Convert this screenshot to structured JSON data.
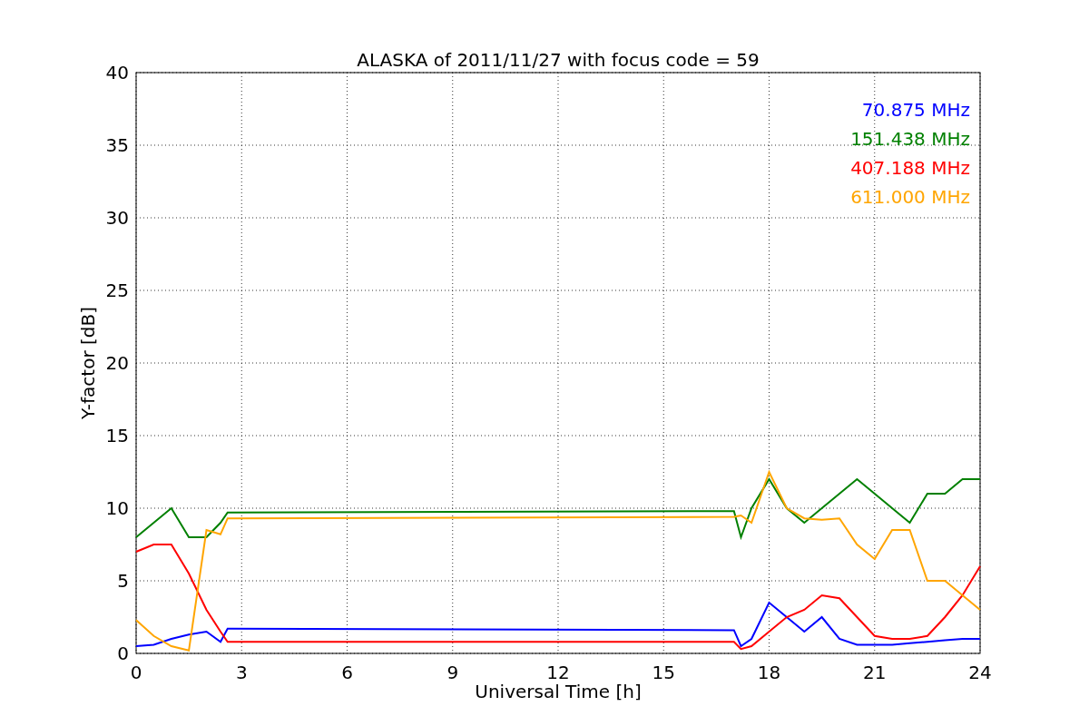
{
  "chart_data": {
    "type": "line",
    "title": "ALASKA of 2011/11/27 with focus code = 59",
    "xlabel": "Universal Time [h]",
    "ylabel": "Y-factor [dB]",
    "x": [
      0,
      0.5,
      1,
      1.5,
      2,
      2.4,
      2.6,
      17,
      17.2,
      17.5,
      18,
      18.5,
      19,
      19.5,
      20,
      20.5,
      21,
      21.5,
      22,
      22.5,
      23,
      23.5,
      24
    ],
    "series": [
      {
        "name": "70.875 MHz",
        "color": "#0000ff",
        "values": [
          0.5,
          0.6,
          1.0,
          1.3,
          1.5,
          0.8,
          1.7,
          1.6,
          0.5,
          1.0,
          3.5,
          2.5,
          1.5,
          2.5,
          1.0,
          0.6,
          0.6,
          0.6,
          0.7,
          0.8,
          0.9,
          1.0,
          1.0
        ]
      },
      {
        "name": "151.438 MHz",
        "color": "#008000",
        "values": [
          8,
          9,
          10,
          8,
          8,
          9,
          9.7,
          9.8,
          8,
          10,
          12,
          10,
          9,
          10,
          11,
          12,
          11,
          10,
          9,
          11,
          11,
          12,
          12
        ]
      },
      {
        "name": "407.188 MHz",
        "color": "#ff0000",
        "values": [
          7,
          7.5,
          7.5,
          5.5,
          3,
          1.5,
          0.8,
          0.8,
          0.3,
          0.5,
          1.5,
          2.5,
          3.0,
          4,
          3.8,
          2.5,
          1.2,
          1.0,
          1.0,
          1.2,
          2.5,
          4,
          6
        ]
      },
      {
        "name": "611.000 MHz",
        "color": "#ffa500",
        "values": [
          2.3,
          1.2,
          0.5,
          0.2,
          8.5,
          8.2,
          9.3,
          9.4,
          9.5,
          9.0,
          12.5,
          10,
          9.3,
          9.2,
          9.3,
          7.5,
          6.5,
          8.5,
          8.5,
          5,
          5,
          4,
          3
        ]
      }
    ],
    "xlim": [
      0,
      24
    ],
    "ylim": [
      0,
      40
    ],
    "xticks": [
      0,
      3,
      6,
      9,
      12,
      15,
      18,
      21,
      24
    ],
    "yticks": [
      0,
      5,
      10,
      15,
      20,
      25,
      30,
      35,
      40
    ],
    "grid": true
  }
}
